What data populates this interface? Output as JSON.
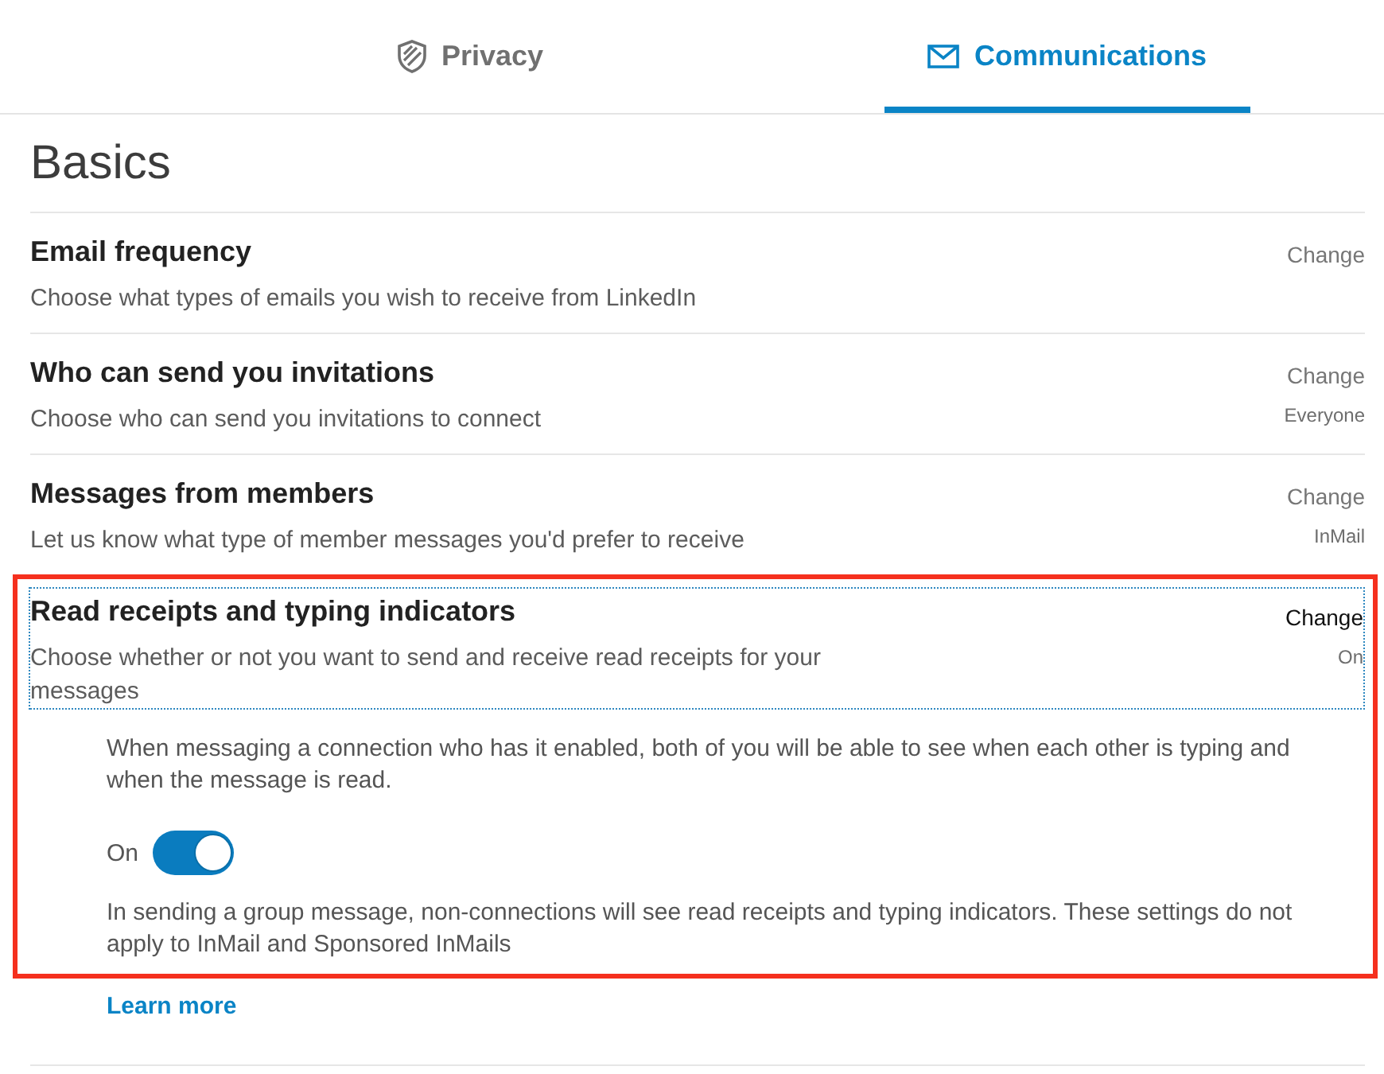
{
  "tabs": [
    {
      "label": "Privacy",
      "selected": false
    },
    {
      "label": "Communications",
      "selected": true
    }
  ],
  "section": {
    "title": "Basics",
    "settings": [
      {
        "title": "Email frequency",
        "description": "Choose what types of emails you wish to receive from LinkedIn",
        "action": "Change",
        "focused": false,
        "highlighted": false
      },
      {
        "title": "Who can send you invitations",
        "description": "Choose who can send you invitations to connect",
        "action": "Change",
        "value": "Everyone",
        "focused": false,
        "highlighted": false
      },
      {
        "title": "Messages from members",
        "description": "Let us know what type of member messages you'd prefer to receive",
        "action": "Change",
        "value": "InMail",
        "focused": false,
        "highlighted": false
      },
      {
        "title": "Read receipts and typing indicators",
        "description": "Choose whether or not you want to send and receive read receipts for your messages",
        "action": "Change",
        "value": "On",
        "focused": true,
        "highlighted": true,
        "details": {
          "intro": "When messaging a connection who has it enabled, both of you will be able to see when each other is typing and when the message is read.",
          "toggle": {
            "label": "On",
            "on": true
          },
          "note": "In sending a group message, non-connections will see read receipts and typing indicators. These settings do not apply to InMail and Sponsored InMails",
          "link": "Learn more"
        }
      }
    ]
  }
}
